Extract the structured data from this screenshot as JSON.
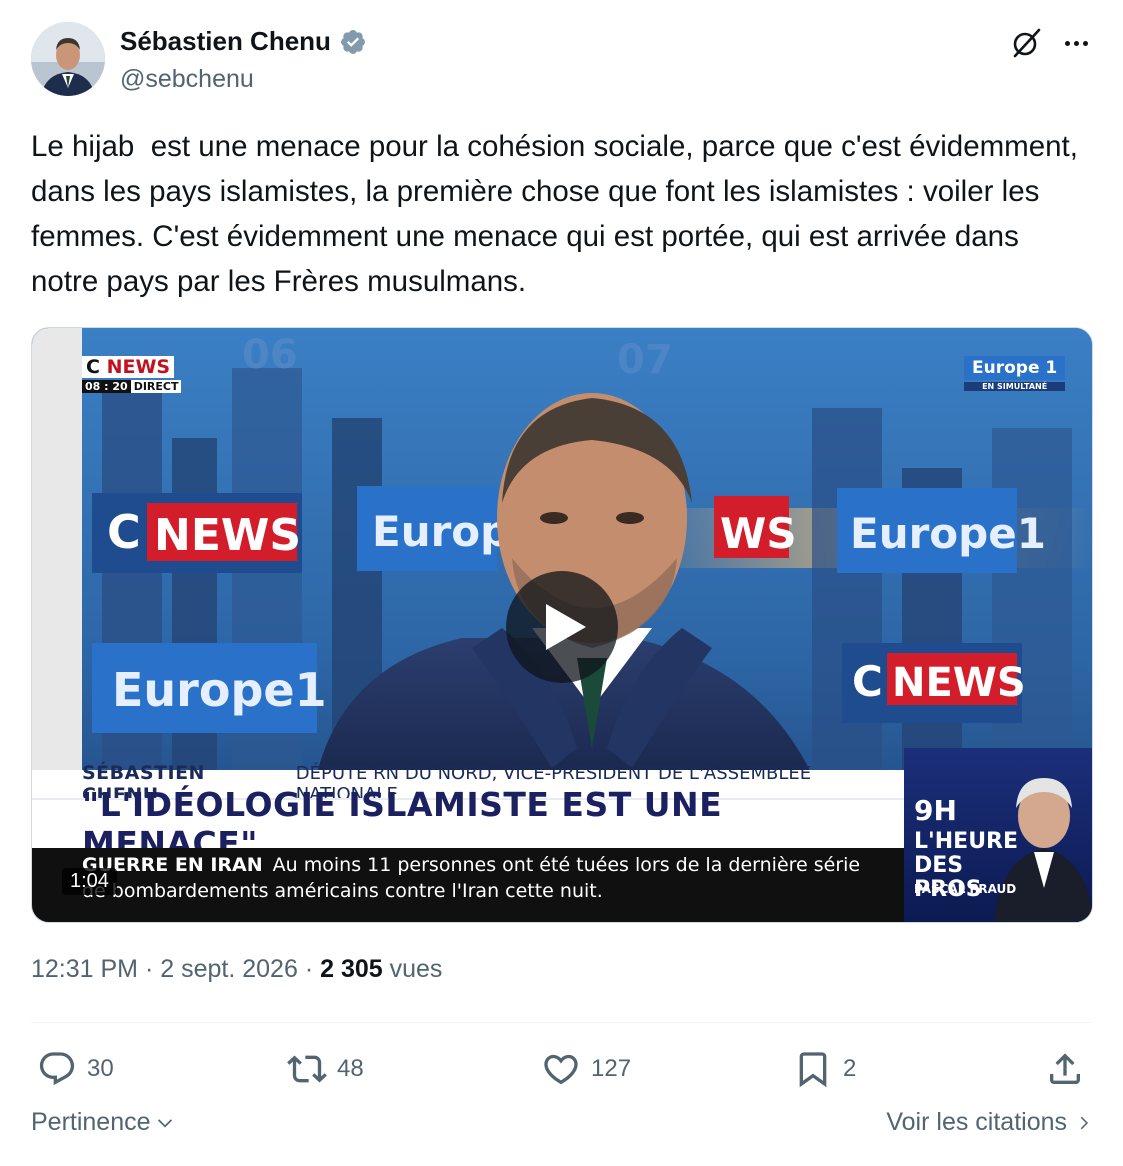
{
  "author": {
    "display_name": "Sébastien Chenu",
    "handle": "@sebchenu",
    "verified": true
  },
  "header_icons": [
    "grok-icon",
    "more-icon"
  ],
  "tweet": {
    "text": "Le hijab  est une menace pour la cohésion sociale, parce que c'est évidemment, dans les pays islamistes, la première chose que font les islamistes : voiler les femmes. C'est évidemment une menace qui est portée, qui est arrivée dans notre pays par les Frères musulmans."
  },
  "video": {
    "duration": "1:04",
    "channel_logo": "C NEWS",
    "channel_time": "08 : 20",
    "channel_live": "DIRECT",
    "partner_logo": "Europe 1",
    "partner_sub": "EN SIMULTANÉ",
    "backdrop_words": [
      "C NEWS",
      "Europe",
      "WS",
      "Europe 1",
      "Europe 1",
      "C NEWS",
      "06",
      "07"
    ],
    "lower_third": {
      "name": "SÉBASTIEN CHENU",
      "role": "DÉPUTÉ RN DU NORD, VICE-PRÉSIDENT DE L'ASSEMBLÉE NATIONALE",
      "headline": "\"L'IDÉOLOGIE ISLAMISTE EST UNE MENACE\"",
      "ticker_label": "GUERRE EN IRAN",
      "ticker_line1": "Au moins 11 personnes ont été tuées lors de la dernière série",
      "ticker_line2": "de bombardements américains contre l'Iran cette nuit."
    },
    "side_panel": {
      "time": "9H",
      "show": "L'HEURE DES PROS",
      "host": "PASCAL PRAUD"
    }
  },
  "meta": {
    "time": "12:31 PM",
    "separator": "·",
    "date": "2 sept. 2026",
    "views_count": "2 305",
    "views_label": "vues"
  },
  "actions": {
    "replies": "30",
    "reposts": "48",
    "likes": "127",
    "bookmarks": "2"
  },
  "footer": {
    "sort_label": "Pertinence",
    "quotes_label": "Voir les citations"
  },
  "colors": {
    "text": "#0f1419",
    "secondary": "#536471",
    "verified": "#829aab",
    "divider": "#eff3f4"
  }
}
